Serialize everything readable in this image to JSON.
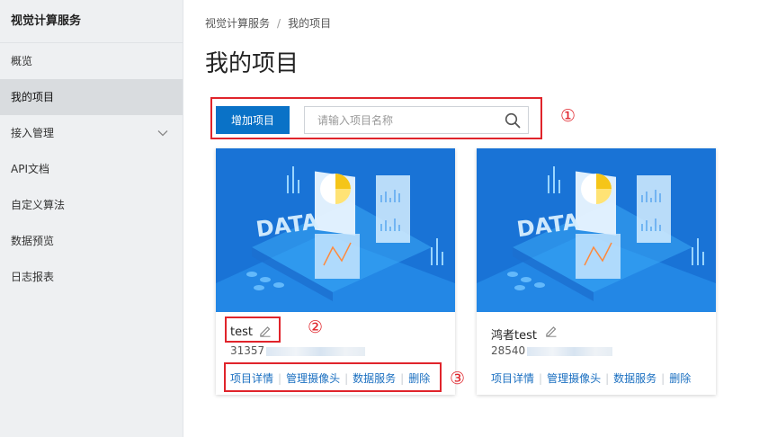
{
  "sidebar": {
    "title": "视觉计算服务",
    "items": [
      {
        "label": "概览"
      },
      {
        "label": "我的项目"
      },
      {
        "label": "接入管理"
      },
      {
        "label": "API文档"
      },
      {
        "label": "自定义算法"
      },
      {
        "label": "数据预览"
      },
      {
        "label": "日志报表"
      }
    ]
  },
  "breadcrumb": {
    "root": "视觉计算服务",
    "separator": "/",
    "current": "我的项目"
  },
  "page_title": "我的项目",
  "toolbar": {
    "add_label": "增加项目",
    "search_placeholder": "请输入项目名称"
  },
  "annotations": {
    "one": "①",
    "two": "②",
    "three": "③"
  },
  "image_text": "DATA",
  "projects": [
    {
      "name": "test",
      "id_prefix": "31357",
      "actions": [
        "项目详情",
        "管理摄像头",
        "数据服务",
        "删除"
      ]
    },
    {
      "name": "鸿者test",
      "id_prefix": "28540",
      "actions": [
        "项目详情",
        "管理摄像头",
        "数据服务",
        "删除"
      ]
    }
  ],
  "colors": {
    "accent": "#0a72c7",
    "highlight": "#e0242b",
    "link": "#1a6fc0"
  },
  "icons": {
    "search": "search-icon",
    "edit": "pencil-icon",
    "expand": "chevron-down-icon",
    "collapse": "chevron-left-icon"
  }
}
